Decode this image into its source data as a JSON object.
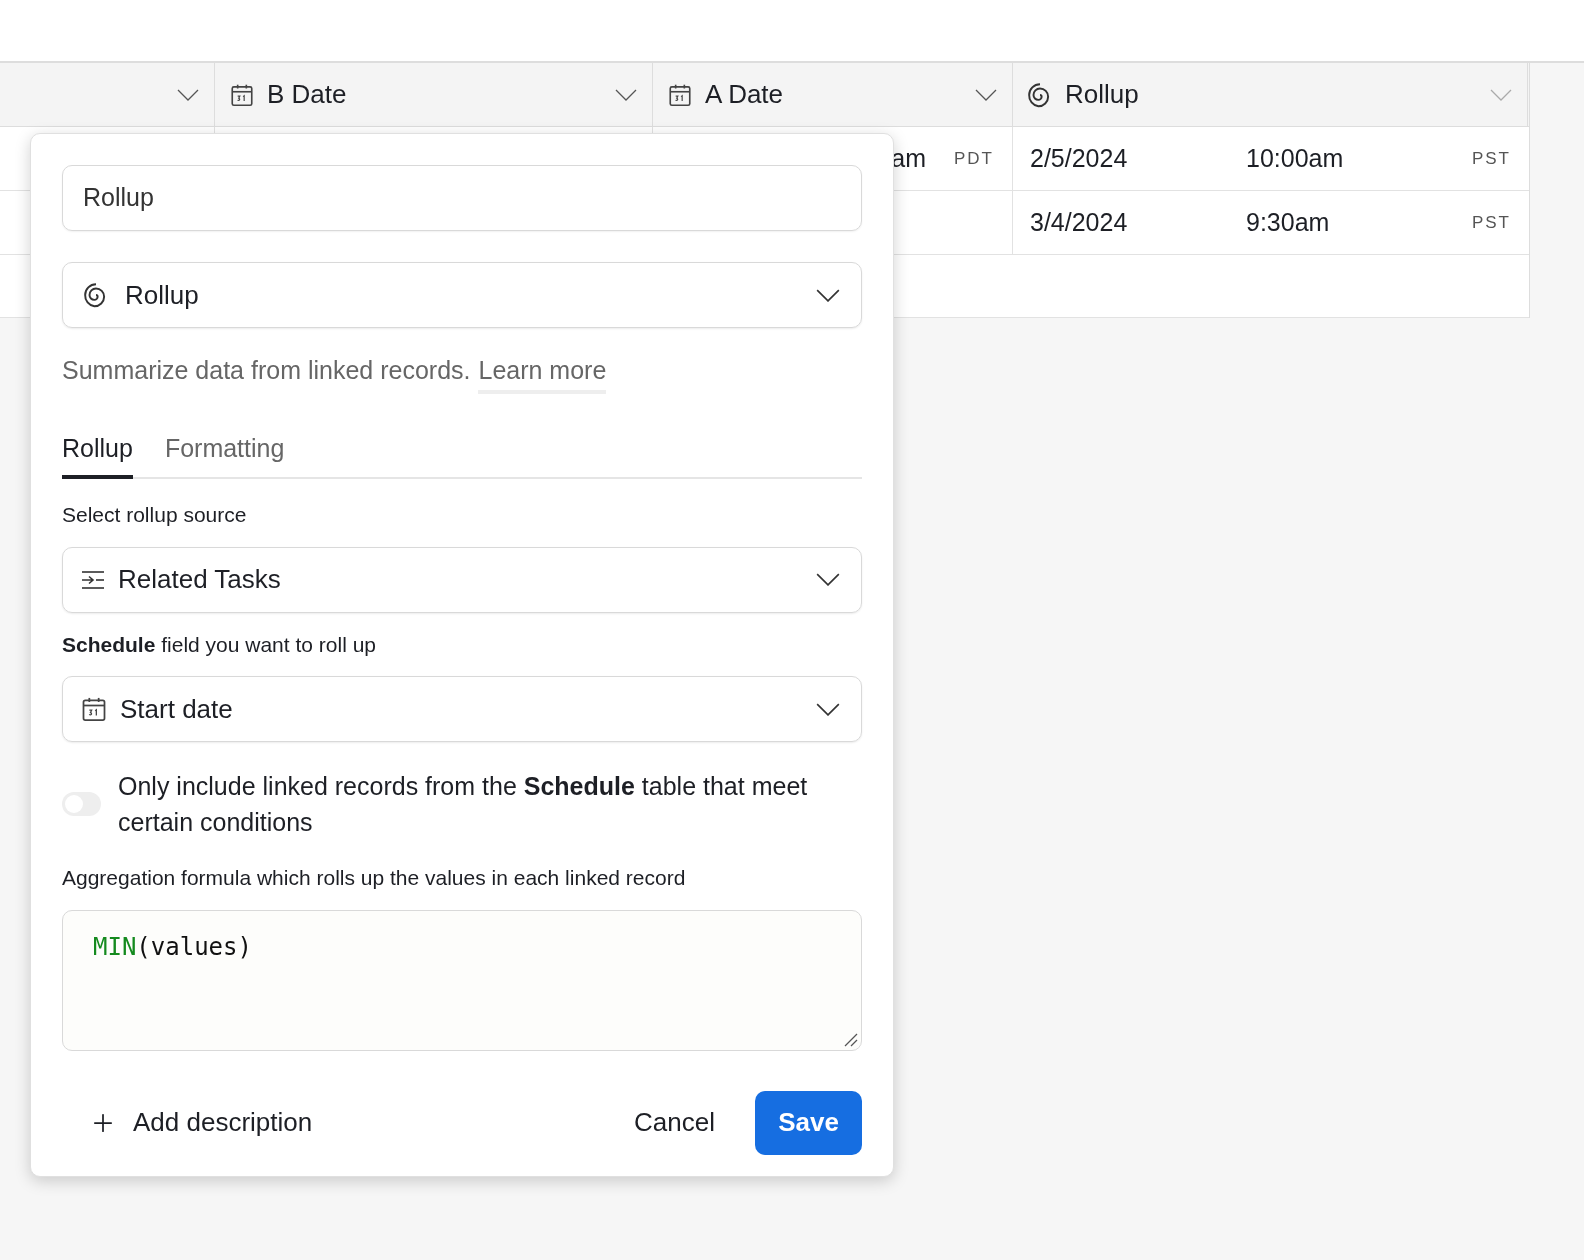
{
  "table": {
    "columns": [
      {
        "kind": "none"
      },
      {
        "label": "B Date",
        "kind": "date"
      },
      {
        "label": "A Date",
        "kind": "date"
      },
      {
        "label": "Rollup",
        "kind": "rollup"
      }
    ],
    "rows": [
      {
        "a_date_time": "am",
        "a_date_zone": "PDT",
        "rollup_date": "2/5/2024",
        "rollup_time": "10:00am",
        "rollup_zone": "PST"
      },
      {
        "rollup_date": "3/4/2024",
        "rollup_time": "9:30am",
        "rollup_zone": "PST"
      }
    ]
  },
  "dialog": {
    "name_value": "Rollup",
    "field_type": "Rollup",
    "description": "Summarize data from linked records.",
    "learn_more": "Learn more",
    "tabs": [
      {
        "label": "Rollup",
        "selected": true
      },
      {
        "label": "Formatting",
        "selected": false
      }
    ],
    "source_label": "Select rollup source",
    "source_value": "Related Tasks",
    "field_label": "**Schedule** field you want to roll up",
    "field_value": "Start date",
    "filter_toggle": {
      "on": false,
      "label": "Only include linked records from the **Schedule** table that meet certain conditions"
    },
    "formula_label": "Aggregation formula which rolls up the values in each linked record",
    "formula": [
      {
        "text": "MIN",
        "kind": "function"
      },
      {
        "text": "(values)",
        "kind": "plain"
      }
    ],
    "add_description": "Add description",
    "cancel": "Cancel",
    "save": "Save"
  }
}
